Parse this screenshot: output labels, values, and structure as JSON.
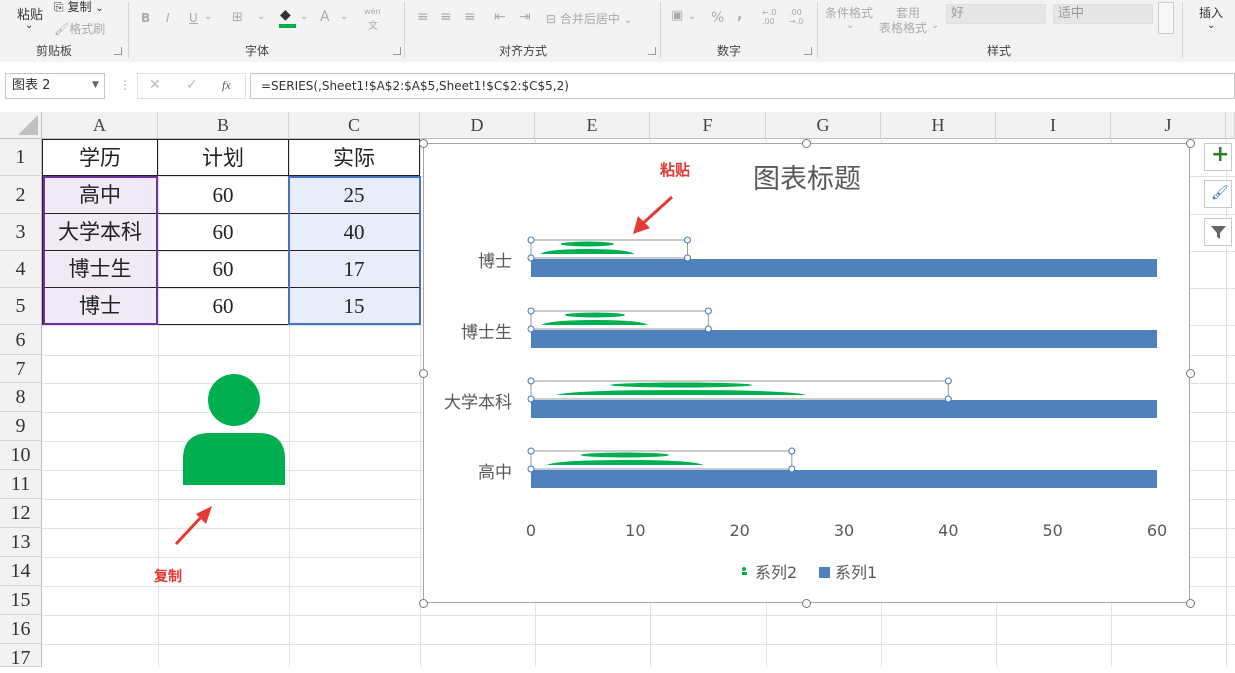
{
  "ribbon": {
    "paste": "粘贴",
    "copy": "复制",
    "format_painter": "格式刷",
    "clipboard": "剪贴板",
    "font_group": "字体",
    "align_group": "对齐方式",
    "merge_center": "合并后居中",
    "number_group": "数字",
    "percent": "%",
    "comma": ",",
    "dec_inc": "←.0\n.00",
    "dec_dec": ".00\n→.0",
    "cond_format": "条件格式",
    "table_format_1": "套用",
    "table_format_2": "表格格式",
    "style_good": "好",
    "style_neutral": "适中",
    "style_group": "样式",
    "insert": "插入",
    "bold": "B",
    "italic": "I",
    "underline": "U",
    "font_color": "A",
    "wen": "wén",
    "wen_char": "文"
  },
  "formula_bar": {
    "name_box": "图表 2",
    "formula": "=SERIES(,Sheet1!$A$2:$A$5,Sheet1!$C$2:$C$5,2)",
    "cancel": "✕",
    "enter": "✓",
    "fx": "fx"
  },
  "columns": [
    "A",
    "B",
    "C",
    "D",
    "E",
    "F",
    "G",
    "H",
    "I",
    "J"
  ],
  "rows": [
    "1",
    "2",
    "3",
    "4",
    "5",
    "6",
    "7",
    "8",
    "9",
    "10",
    "11",
    "12",
    "13",
    "14",
    "15",
    "16",
    "17"
  ],
  "table": {
    "headers": [
      "学历",
      "计划",
      "实际"
    ],
    "rows": [
      [
        "高中",
        "60",
        "25"
      ],
      [
        "大学本科",
        "60",
        "40"
      ],
      [
        "博士生",
        "60",
        "17"
      ],
      [
        "博士",
        "60",
        "15"
      ]
    ]
  },
  "annotations": {
    "copy_label": "复制",
    "paste_label": "粘贴",
    "arrow_color": "#e53935"
  },
  "chart_data": {
    "type": "bar",
    "orientation": "horizontal",
    "title": "图表标题",
    "categories": [
      "高中",
      "大学本科",
      "博士生",
      "博士"
    ],
    "series": [
      {
        "name": "系列1",
        "values": [
          60,
          60,
          60,
          60
        ],
        "color": "#4f81bd"
      },
      {
        "name": "系列2",
        "values": [
          25,
          40,
          17,
          15
        ],
        "color": "#00b050"
      }
    ],
    "xlim": [
      0,
      60
    ],
    "xticks": [
      "0",
      "10",
      "20",
      "30",
      "40",
      "50",
      "60"
    ],
    "legend": [
      "系列2",
      "系列1"
    ],
    "legend_position": "bottom",
    "grid": false
  },
  "colors": {
    "person_icon": "#00b050",
    "bar_blue": "#4f81bd",
    "header_fill": "#f2f2f2"
  }
}
